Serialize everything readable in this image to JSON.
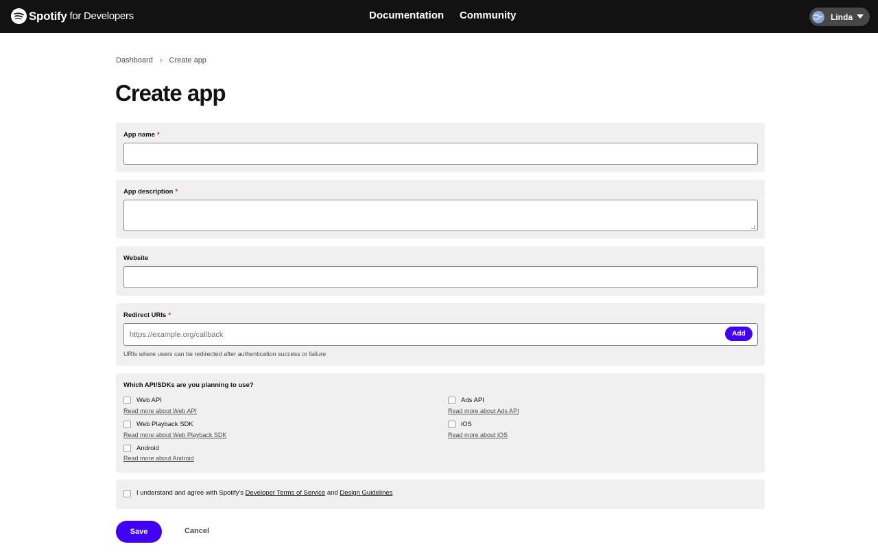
{
  "header": {
    "brand_name": "Spotify",
    "brand_suffix": "for Developers",
    "nav": [
      {
        "label": "Documentation"
      },
      {
        "label": "Community"
      }
    ],
    "user_name": "Linda",
    "background_color": "#121212"
  },
  "breadcrumb": {
    "items": [
      "Dashboard",
      "Create app"
    ],
    "separator": "›"
  },
  "page_title": "Create app",
  "form": {
    "app_name": {
      "label": "App name",
      "required_mark": "*",
      "value": ""
    },
    "app_description": {
      "label": "App description",
      "required_mark": "*",
      "value": ""
    },
    "website": {
      "label": "Website",
      "value": ""
    },
    "redirect_uris": {
      "label": "Redirect URIs",
      "required_mark": "*",
      "placeholder": "https://example.org/callback",
      "add_label": "Add",
      "hint": "URIs where users can be redirected after authentication success or failure"
    },
    "apis": {
      "question": "Which API/SDKs are you planning to use?",
      "options": [
        {
          "label": "Web API",
          "link": "Read more about Web API",
          "checked": false
        },
        {
          "label": "Ads API",
          "link": "Read more about Ads API",
          "checked": false
        },
        {
          "label": "Web Playback SDK",
          "link": "Read more about Web Playback SDK",
          "checked": false
        },
        {
          "label": "iOS",
          "link": "Read more about iOS",
          "checked": false
        },
        {
          "label": "Android",
          "link": "Read more about Android",
          "checked": false
        }
      ]
    },
    "terms": {
      "prefix": "I understand and agree with Spotify's",
      "tos_link": "Developer Terms of Service",
      "and": "and",
      "guidelines_link": "Design Guidelines",
      "checked": false
    },
    "save_label": "Save",
    "cancel_label": "Cancel"
  },
  "colors": {
    "accent": "#4100f4",
    "required": "#e91429",
    "section_bg": "#f0f0f0"
  }
}
